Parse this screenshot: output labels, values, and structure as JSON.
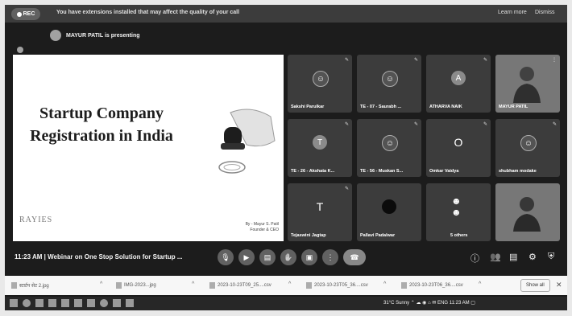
{
  "banner": {
    "rec_label": "REC",
    "message": "You have extensions installed that may affect the quality of your call",
    "learn_more": "Learn more",
    "dismiss": "Dismiss"
  },
  "presenting": "MAYUR PATIL is presenting",
  "slide": {
    "title_line1": "Startup Company",
    "title_line2": "Registration in India",
    "logo": "RAYIES",
    "byline1": "By - Mayur S. Patil",
    "byline2": "Founder & CEO"
  },
  "participants": [
    {
      "name": "Sakshi Parulkar",
      "avatar": "photo"
    },
    {
      "name": "TE - 07 - Saurabh ...",
      "avatar": "photo"
    },
    {
      "name": "ATHARVA NAIK",
      "avatar": "A"
    },
    {
      "name": "MAYUR PATIL",
      "avatar": "camera"
    },
    {
      "name": "TE - 26 - Akshata K...",
      "avatar": "T"
    },
    {
      "name": "TE - 56 - Muskan S...",
      "avatar": "photo"
    },
    {
      "name": "Omkar Vaidya",
      "avatar": "O"
    },
    {
      "name": "shubham modake",
      "avatar": "photo"
    },
    {
      "name": "Tejaswini Jagtap",
      "avatar": "T"
    },
    {
      "name": "Pallavi Padalwar",
      "avatar": "dark"
    },
    {
      "name": "5 others",
      "avatar": "group"
    },
    {
      "name": "",
      "avatar": "camera"
    }
  ],
  "meeting": {
    "time": "11:23 AM",
    "separator": "|",
    "title": "Webinar on One Stop Solution for Startup ..."
  },
  "downloads": [
    {
      "name": "स्टार्टप सेट 2.jpg"
    },
    {
      "name": "IMG-2023...jpg"
    },
    {
      "name": "2023-10-23T09_25....csv"
    },
    {
      "name": "2023-10-23T05_36....csv"
    },
    {
      "name": "2023-10-23T06_36....csv"
    }
  ],
  "downloads_show_all": "Show all",
  "tray": {
    "weather": "31°C Sunny",
    "lang": "ENG",
    "clock": "11:23 AM"
  }
}
